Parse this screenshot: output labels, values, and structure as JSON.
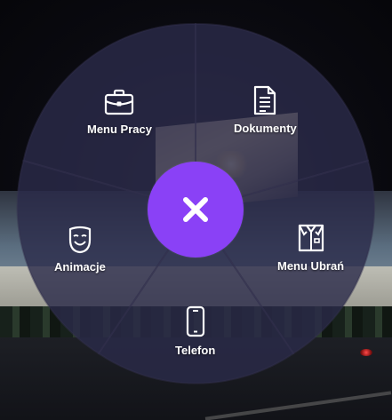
{
  "radial_menu": {
    "accent_color": "#8a41f6",
    "segment_color": "rgba(42,43,74,0.80)",
    "items": [
      {
        "id": "work",
        "label": "Menu Pracy",
        "icon": "briefcase-icon"
      },
      {
        "id": "docs",
        "label": "Dokumenty",
        "icon": "document-icon"
      },
      {
        "id": "clothes",
        "label": "Menu Ubrań",
        "icon": "shirt-icon"
      },
      {
        "id": "phone",
        "label": "Telefon",
        "icon": "phone-icon"
      },
      {
        "id": "emotes",
        "label": "Animacje",
        "icon": "mask-icon"
      }
    ],
    "close_icon": "close-icon"
  }
}
